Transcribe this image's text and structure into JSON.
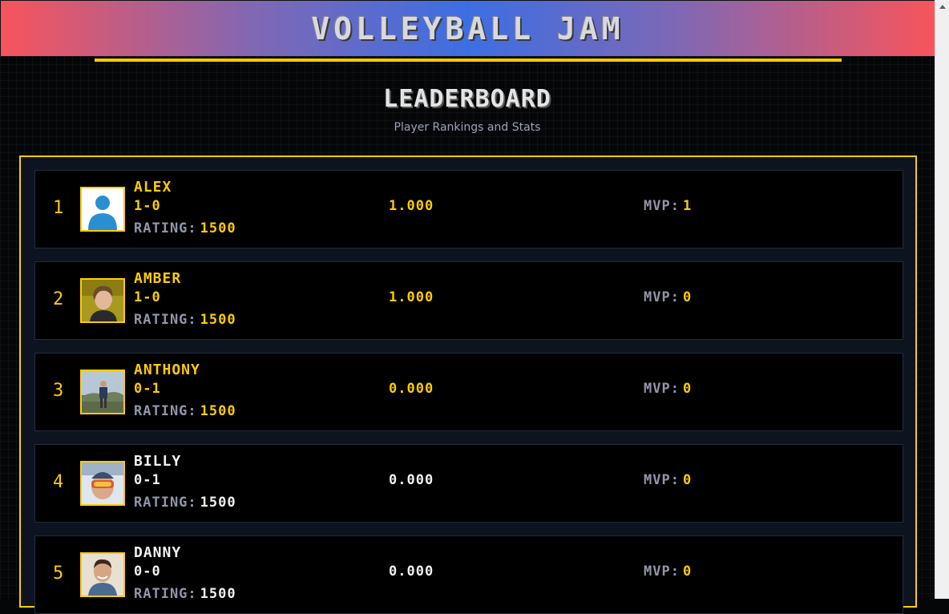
{
  "app": {
    "title": "VOLLEYBALL JAM"
  },
  "leaderboard": {
    "title": "LEADERBOARD",
    "subtitle": "Player Rankings and Stats",
    "rating_label": "RATING:",
    "mvp_label": "MVP:",
    "players": [
      {
        "rank": "1",
        "name": "ALEX",
        "record": "1-0",
        "pct": "1.000",
        "rating": "1500",
        "mvp": "1",
        "avatar": "default-avatar-icon",
        "color": "#ffcc00"
      },
      {
        "rank": "2",
        "name": "AMBER",
        "record": "1-0",
        "pct": "1.000",
        "rating": "1500",
        "mvp": "0",
        "avatar": "player-photo",
        "color": "#ffcc00"
      },
      {
        "rank": "3",
        "name": "ANTHONY",
        "record": "0-1",
        "pct": "0.000",
        "rating": "1500",
        "mvp": "0",
        "avatar": "player-photo",
        "color": "#ffcc00"
      },
      {
        "rank": "4",
        "name": "BILLY",
        "record": "0-1",
        "pct": "0.000",
        "rating": "1500",
        "mvp": "0",
        "avatar": "player-photo",
        "color": "#f2f2f2"
      },
      {
        "rank": "5",
        "name": "DANNY",
        "record": "0-0",
        "pct": "0.000",
        "rating": "1500",
        "mvp": "0",
        "avatar": "player-photo",
        "color": "#f2f2f2"
      }
    ]
  },
  "theme": {
    "accent": "#ffcc00",
    "banner_left": "#f8545b",
    "banner_center": "#3c6ee3",
    "muted": "#8f97a8"
  }
}
